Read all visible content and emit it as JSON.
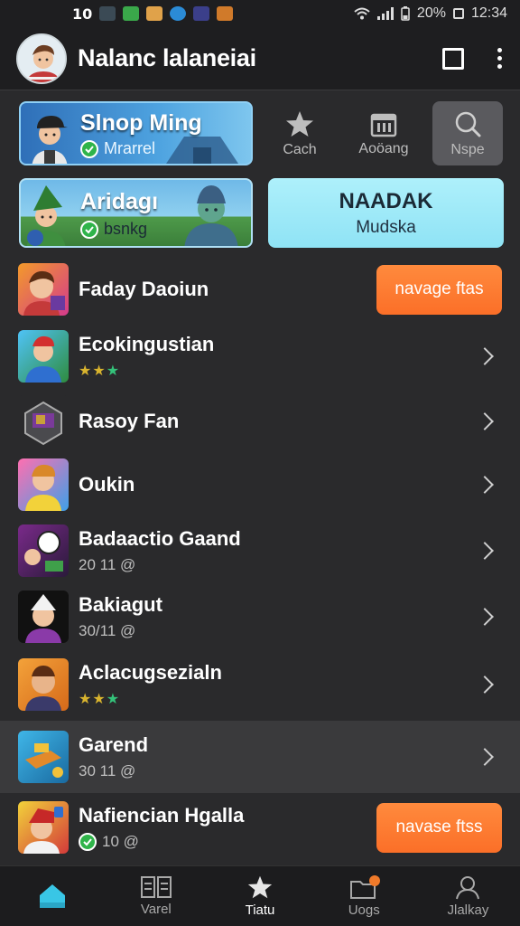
{
  "status_bar": {
    "left_text": "10",
    "battery": "20%",
    "time": "12:34"
  },
  "header": {
    "title": "Nalanc lalaneiai"
  },
  "featured": {
    "banner_1": {
      "title": "Slnop Ming",
      "subtitle": "Mrarrel"
    },
    "banner_2": {
      "title": "Aridagı",
      "subtitle": "bsnkg"
    },
    "cta": {
      "title": "NAADAK",
      "subtitle": "Mudska"
    },
    "quick_actions": [
      {
        "label": "Cach",
        "icon": "star-icon"
      },
      {
        "label": "Aoöang",
        "icon": "calendar-icon"
      },
      {
        "label": "Nspe",
        "icon": "search-icon"
      }
    ]
  },
  "list": {
    "items": [
      {
        "title": "Faday Daoiun",
        "meta": "",
        "action": "navage ftas"
      },
      {
        "title": "Ecokingustian",
        "meta": "stars"
      },
      {
        "title": "Rasoy Fan",
        "meta": ""
      },
      {
        "title": "Oukin",
        "meta": ""
      },
      {
        "title": "Badaactio Gaand",
        "meta": "20 11 @"
      },
      {
        "title": "Bakiagut",
        "meta": "30/11 @"
      },
      {
        "title": "Aclacugsezialn",
        "meta": "stars"
      },
      {
        "title": "Garend",
        "meta": "30 11 @"
      },
      {
        "title": "Nafiencian Hgalla",
        "meta": "10 @",
        "action": "navase ftss"
      }
    ]
  },
  "bottom_nav": {
    "items": [
      {
        "label": "",
        "icon": "home-icon"
      },
      {
        "label": "Varel",
        "icon": "grid-icon"
      },
      {
        "label": "Tiatu",
        "icon": "star-icon"
      },
      {
        "label": "Uogs",
        "icon": "folder-icon"
      },
      {
        "label": "Jlalkay",
        "icon": "person-icon"
      }
    ]
  },
  "colors": {
    "accent_orange": "#fb6f28",
    "accent_cyan": "#8fe3f5",
    "active_tab": "#39c6e6"
  }
}
